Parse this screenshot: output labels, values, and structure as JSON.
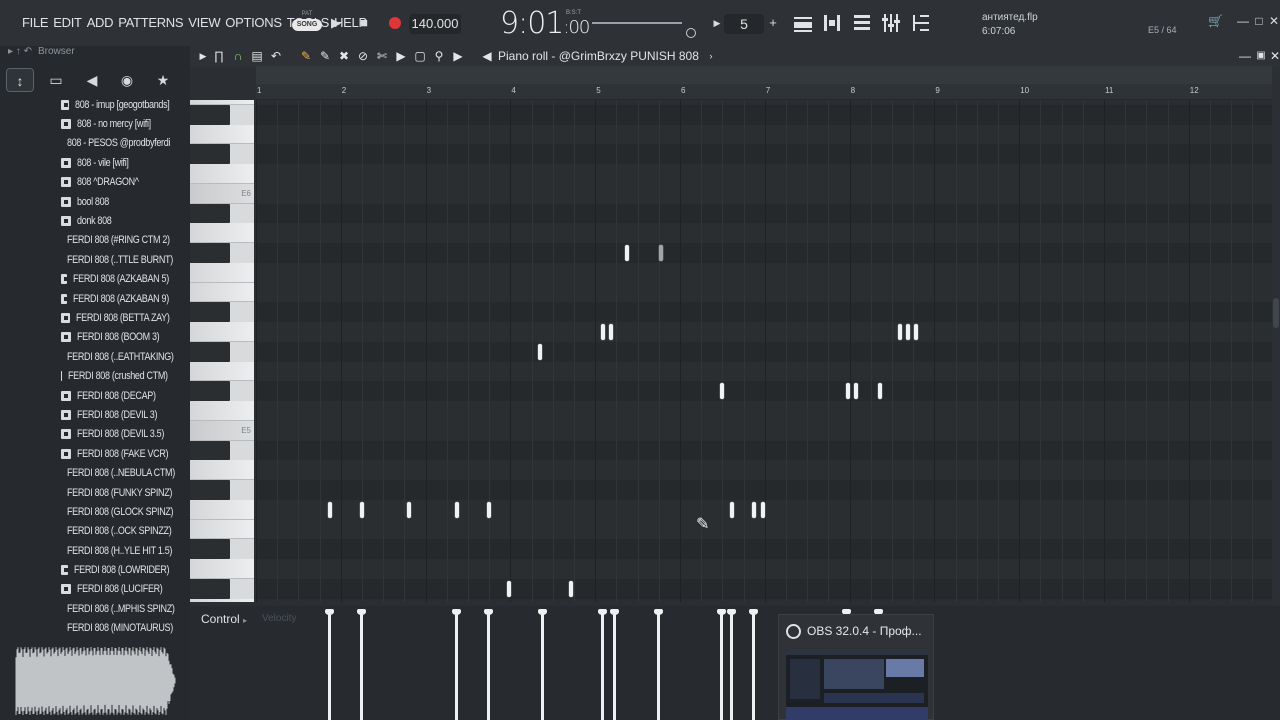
{
  "menu": [
    "FILE",
    "EDIT",
    "ADD",
    "PATTERNS",
    "VIEW",
    "OPTIONS",
    "TOOLS",
    "HELP"
  ],
  "transport": {
    "pat_label": "PAT",
    "song_label": "SONG",
    "play_icon": "play-icon",
    "stop_icon": "stop-icon",
    "record_icon": "record-icon",
    "record_color": "#e0363a",
    "tempo": "140.000",
    "time": "9:01",
    "time_fraction": ":00",
    "time_sub": "B:S:T",
    "pattern_number": "5"
  },
  "project": {
    "file_name": "антиятед.flp",
    "duration": "6:07:06",
    "cpu": "E5 / 64"
  },
  "browser": {
    "header": "Browser",
    "items": [
      "808 - imup [geogotbands]",
      "808 - no mercy [wifi]",
      "808 - PESOS @prodbyferdi",
      "808 - vile [wifi]",
      "808 ^DRAGON^",
      "bool 808",
      "donk 808",
      "FERDI 808 (#RING CTM 2)",
      "FERDI 808 (..TTLE BURNT)",
      "FERDI 808 (AZKABAN 5)",
      "FERDI 808 (AZKABAN 9)",
      "FERDI 808 (BETTA ZAY)",
      "FERDI 808 (BOOM 3)",
      "FERDI 808 (..EATHTAKING)",
      "FERDI 808 (crushed CTM)",
      "FERDI 808 (DECAP)",
      "FERDI 808 (DEVIL 3)",
      "FERDI 808 (DEVIL 3.5)",
      "FERDI 808 (FAKE VCR)",
      "FERDI 808 (..NEBULA CTM)",
      "FERDI 808 (FUNKY SPINZ)",
      "FERDI 808 (GLOCK SPINZ)",
      "FERDI 808 (..OCK SPINZZ)",
      "FERDI 808 (H..YLE HIT 1.5)",
      "FERDI 808 (LOWRIDER)",
      "FERDI 808 (LUCIFER)",
      "FERDI 808 (..MPHIS SPINZ)",
      "FERDI 808 (MINOTAURUS)"
    ]
  },
  "piano_roll": {
    "title": "Piano roll - @GrimBrxzy PUNISH 808",
    "bars": [
      "1",
      "2",
      "3",
      "4",
      "5",
      "6",
      "7",
      "8",
      "9",
      "10",
      "11",
      "12"
    ],
    "key_labels": [
      "E6",
      "E5"
    ],
    "control_label": "Control",
    "control_target": "Velocity"
  },
  "obs": {
    "title": "OBS 32.0.4 - Проф..."
  }
}
